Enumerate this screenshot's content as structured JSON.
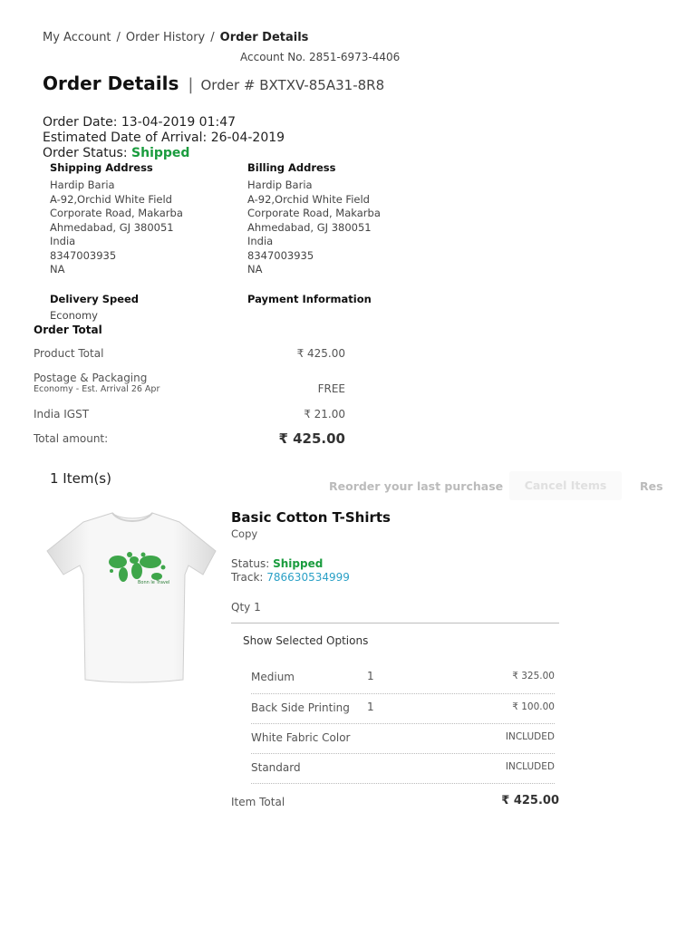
{
  "breadcrumb": {
    "my_account": "My Account",
    "sep": "/",
    "order_history": "Order History",
    "current": "Order Details"
  },
  "account": "Account No. 2851-6973-4406",
  "header": {
    "title": "Order Details",
    "separator": "|",
    "order_number": "Order # BXTXV-85A31-8R8"
  },
  "order_meta": {
    "order_date_label": "Order Date: ",
    "order_date": "13-04-2019 01:47",
    "eta_label": "Estimated Date of Arrival: ",
    "eta": "26-04-2019",
    "status_label": "Order Status: ",
    "status": "Shipped"
  },
  "shipping_address": {
    "heading": "Shipping Address",
    "lines": [
      "Hardip Baria",
      "A-92,Orchid White Field",
      "Corporate Road, Makarba",
      "Ahmedabad, GJ 380051",
      "India",
      "8347003935",
      "NA"
    ]
  },
  "billing_address": {
    "heading": "Billing Address",
    "lines": [
      "Hardip Baria",
      "A-92,Orchid White Field",
      "Corporate Road, Makarba",
      "Ahmedabad, GJ 380051",
      "India",
      "8347003935",
      "NA"
    ]
  },
  "delivery": {
    "heading": "Delivery Speed",
    "value": "Economy"
  },
  "payment": {
    "heading": "Payment Information"
  },
  "order_total": {
    "heading": "Order Total",
    "product_total_label": "Product Total",
    "product_total": "₹ 425.00",
    "postage_label": "Postage & Packaging",
    "postage_sub": "Economy - Est. Arrival 26 Apr",
    "postage": "FREE",
    "igst_label": "India IGST",
    "igst": "₹ 21.00",
    "total_label": "Total amount:",
    "total": "₹ 425.00"
  },
  "items_header": {
    "count": "1 Item(s)",
    "reorder": "Reorder your last purchase",
    "cancel": "Cancel Items",
    "res": "Res"
  },
  "item": {
    "title": "Basic Cotton T-Shirts",
    "copy": "Copy",
    "status_label": "Status: ",
    "status": "Shipped",
    "track_label": "Track: ",
    "track_number": "786630534999",
    "qty": "Qty 1",
    "show_options": "Show Selected Options",
    "image_text": "Bonn le Travel",
    "options": [
      {
        "name": "Medium",
        "qty": "1",
        "price": "₹ 325.00"
      },
      {
        "name": "Back Side Printing",
        "qty": "1",
        "price": "₹ 100.00"
      },
      {
        "name": "White Fabric Color",
        "qty": "",
        "price": "INCLUDED"
      },
      {
        "name": "Standard",
        "qty": "",
        "price": "INCLUDED"
      }
    ],
    "item_total_label": "Item Total",
    "item_total": "₹ 425.00"
  },
  "colors": {
    "status_green": "#1a9c3e",
    "link_blue": "#2aa0c6",
    "map_green": "#3ea64a"
  }
}
